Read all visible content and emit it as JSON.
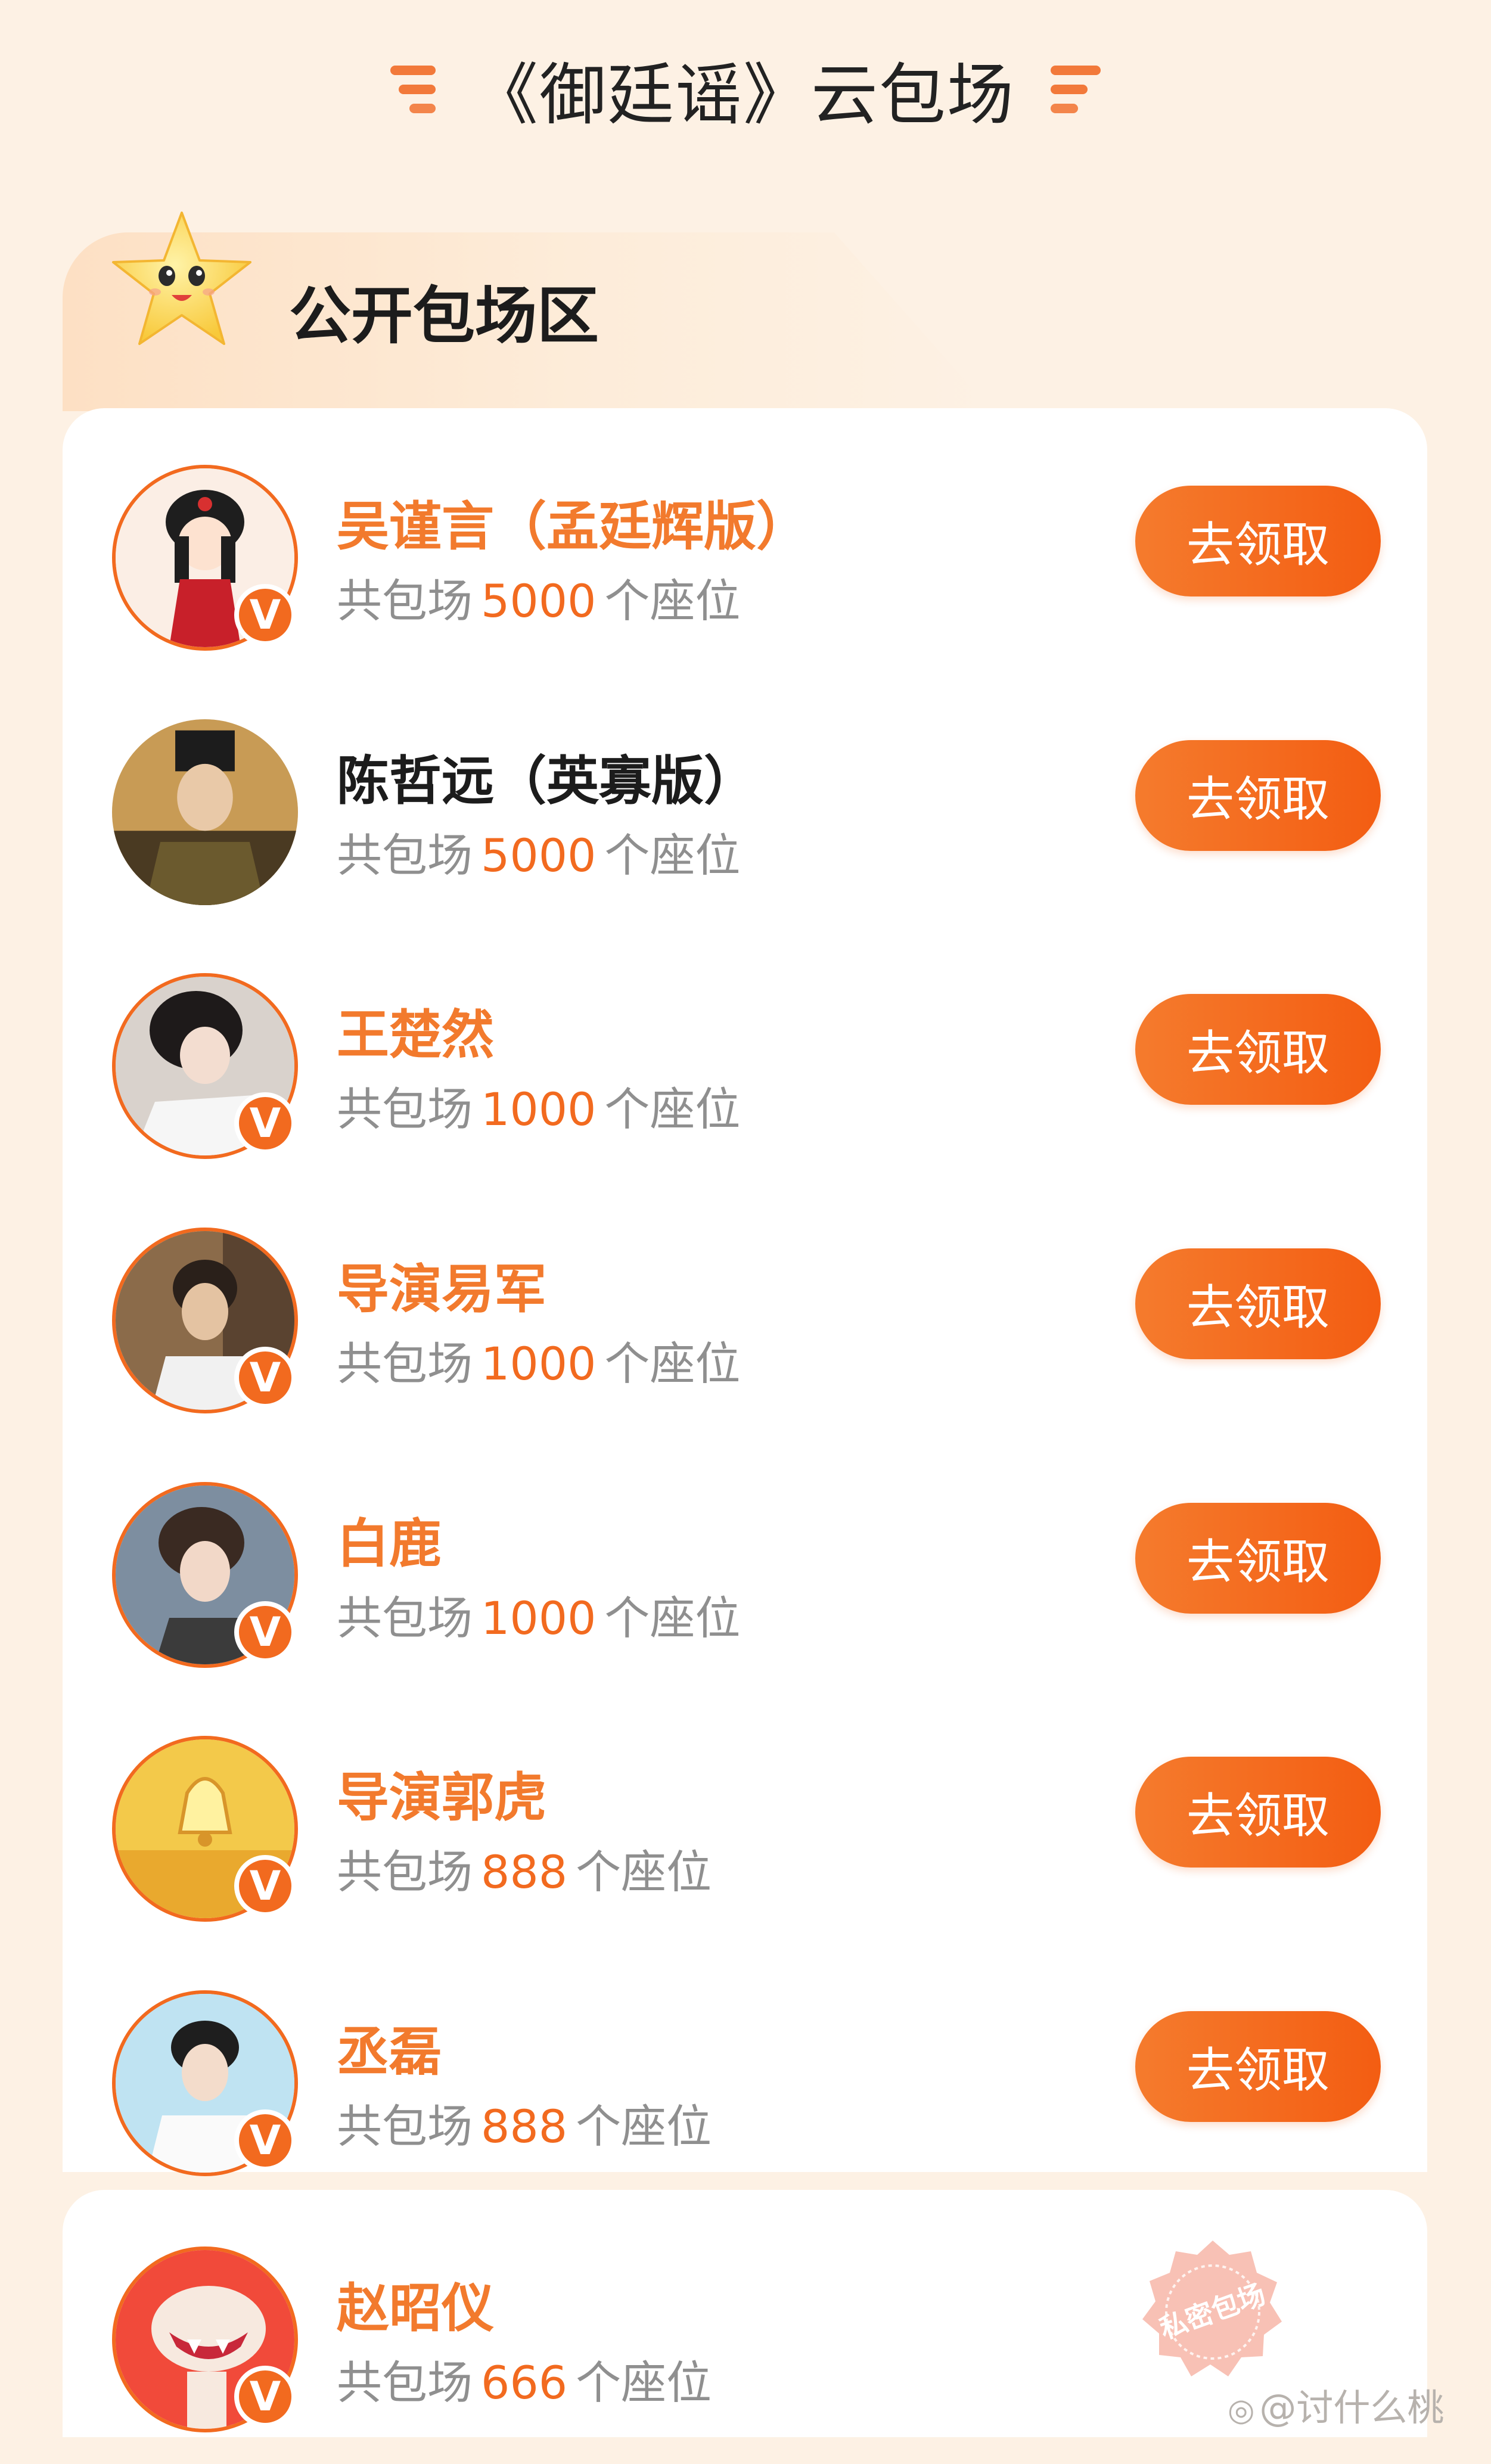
{
  "header": {
    "title": "《御廷谣》云包场"
  },
  "section": {
    "title": "公开包场区"
  },
  "seat_prefix": "共包场",
  "seat_suffix": "个座位",
  "claim_label": "去领取",
  "entries": [
    {
      "name": "吴谨言（孟廷辉版）",
      "seats": "5000",
      "verified": true
    },
    {
      "name": "陈哲远（英寡版）",
      "seats": "5000",
      "verified": false
    },
    {
      "name": "王楚然",
      "seats": "1000",
      "verified": true
    },
    {
      "name": "导演易军",
      "seats": "1000",
      "verified": true
    },
    {
      "name": "白鹿",
      "seats": "1000",
      "verified": true
    },
    {
      "name": "导演郭虎",
      "seats": "888",
      "verified": true
    },
    {
      "name": "丞磊",
      "seats": "888",
      "verified": true
    },
    {
      "name": "赵昭仪",
      "seats": "666",
      "verified": true
    }
  ],
  "badge": {
    "letter": "V"
  },
  "stamp": {
    "text": "私密包场"
  },
  "watermark": {
    "icon": "weibo-icon",
    "text": "@讨什么桃"
  },
  "colors": {
    "accent": "#f26a1f",
    "name_orange": "#f27a2d",
    "background": "#fdf1e4",
    "muted_text": "#8f8f8f"
  }
}
